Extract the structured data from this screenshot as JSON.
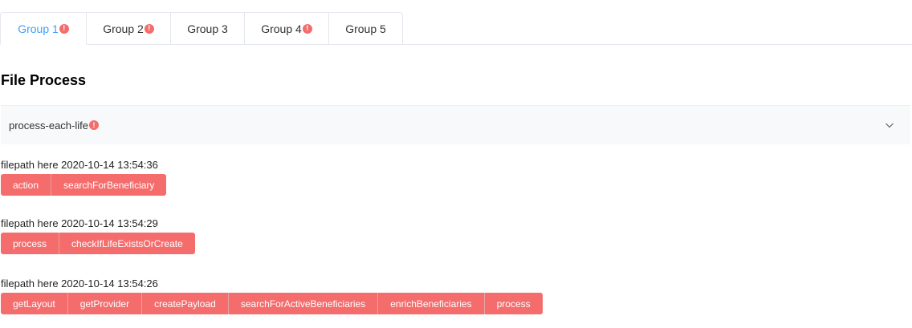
{
  "tabs": [
    {
      "label": "Group 1",
      "warning": true,
      "active": true
    },
    {
      "label": "Group 2",
      "warning": true,
      "active": false
    },
    {
      "label": "Group 3",
      "warning": false,
      "active": false
    },
    {
      "label": "Group 4",
      "warning": true,
      "active": false
    },
    {
      "label": "Group 5",
      "warning": false,
      "active": false
    }
  ],
  "page_title": "File Process",
  "collapse": {
    "label": "process-each-life",
    "warning": true,
    "icon": "chevron-down-icon"
  },
  "warning_glyph": "!",
  "entries": [
    {
      "info": "filepath here 2020-10-14 13:54:36",
      "steps": [
        "action",
        "searchForBeneficiary"
      ]
    },
    {
      "info": "filepath here 2020-10-14 13:54:29",
      "steps": [
        "process",
        "checkIfLifeExistsOrCreate"
      ]
    },
    {
      "info": "filepath here 2020-10-14 13:54:26",
      "steps": [
        "getLayout",
        "getProvider",
        "createPayload",
        "searchForActiveBeneficiaries",
        "enrichBeneficiaries",
        "process"
      ]
    }
  ],
  "colors": {
    "accent": "#409eff",
    "error": "#f56c6c"
  }
}
